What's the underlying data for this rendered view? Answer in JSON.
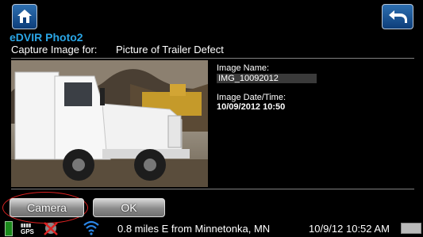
{
  "header": {
    "app_title": "eDVIR Photo2",
    "capture_label": "Capture Image for:",
    "capture_value": "Picture of Trailer Defect"
  },
  "details": {
    "image_name_label": "Image Name:",
    "image_name_value": "IMG_10092012",
    "image_date_label": "Image Date/Time:",
    "image_date_value": "10/09/2012 10:50"
  },
  "buttons": {
    "camera_label": "Camera",
    "ok_label": "OK"
  },
  "status_bar": {
    "gps_label": "GPS",
    "location": "0.8 miles E from Minnetonka, MN",
    "datetime": "10/9/12 10:52 AM"
  },
  "colors": {
    "title_accent": "#2aa6e6",
    "button_blue": "#2d6fb0",
    "annotation_red": "#d22222"
  },
  "icons": [
    "home-icon",
    "back-arrow-icon",
    "battery-icon",
    "gps-icon",
    "gps-off-icon",
    "wifi-icon",
    "keyboard-icon"
  ]
}
